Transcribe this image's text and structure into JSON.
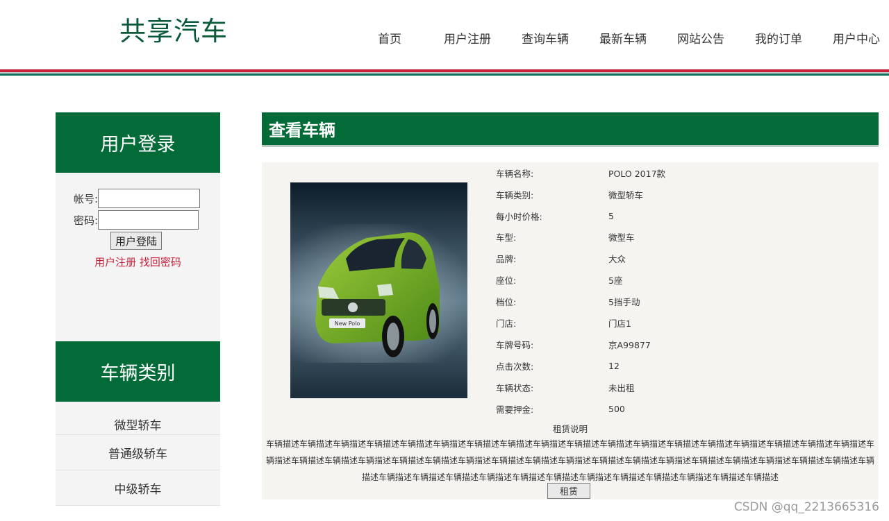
{
  "header": {
    "logo": "共享汽车",
    "nav": [
      "首页",
      "用户注册",
      "查询车辆",
      "最新车辆",
      "网站公告",
      "我的订单",
      "用户中心"
    ]
  },
  "sidebar": {
    "login_title": "用户登录",
    "account_label": "帐号:",
    "password_label": "密码:",
    "account_value": "",
    "password_value": "",
    "login_button": "用户登陆",
    "register_link": "用户注册",
    "recover_link": "找回密码",
    "category_title": "车辆类别",
    "categories": [
      "微型轿车",
      "普通级轿车",
      "中级轿车"
    ]
  },
  "main": {
    "title": "查看车辆",
    "specs": [
      {
        "label": "车辆名称:",
        "value": "POLO 2017款"
      },
      {
        "label": "车辆类别:",
        "value": "微型轿车"
      },
      {
        "label": "每小时价格:",
        "value": "5"
      },
      {
        "label": "车型:",
        "value": "微型车"
      },
      {
        "label": "品牌:",
        "value": "大众"
      },
      {
        "label": "座位:",
        "value": "5座"
      },
      {
        "label": "档位:",
        "value": "5挡手动"
      },
      {
        "label": "门店:",
        "value": "门店1"
      },
      {
        "label": "车牌号码:",
        "value": "京A99877"
      },
      {
        "label": "点击次数:",
        "value": "12"
      },
      {
        "label": "车辆状态:",
        "value": "未出租"
      },
      {
        "label": "需要押金:",
        "value": "500"
      }
    ],
    "rent_title": "租赁说明",
    "rent_desc": "车辆描述车辆描述车辆描述车辆描述车辆描述车辆描述车辆描述车辆描述车辆描述车辆描述车辆描述车辆描述车辆描述车辆描述车辆描述车辆描述车辆描述车辆描述车辆描述车辆描述车辆描述车辆描述车辆描述车辆描述车辆描述车辆描述车辆描述车辆描述车辆描述车辆描述车辆描述车辆描述车辆描述车辆描述车辆描述车辆描述车辆描述车辆描述车辆描述车辆描述车辆描述车辆描述车辆描述车辆描述车辆描述车辆描述车辆描述车辆描述车辆描述",
    "rent_button": "租赁",
    "car_badge": "New Polo"
  },
  "watermark": "CSDN @qq_2213665316",
  "colors": {
    "brand_green": "#036b38",
    "accent_red": "#c8203a",
    "car_green": "#7bb52c"
  }
}
